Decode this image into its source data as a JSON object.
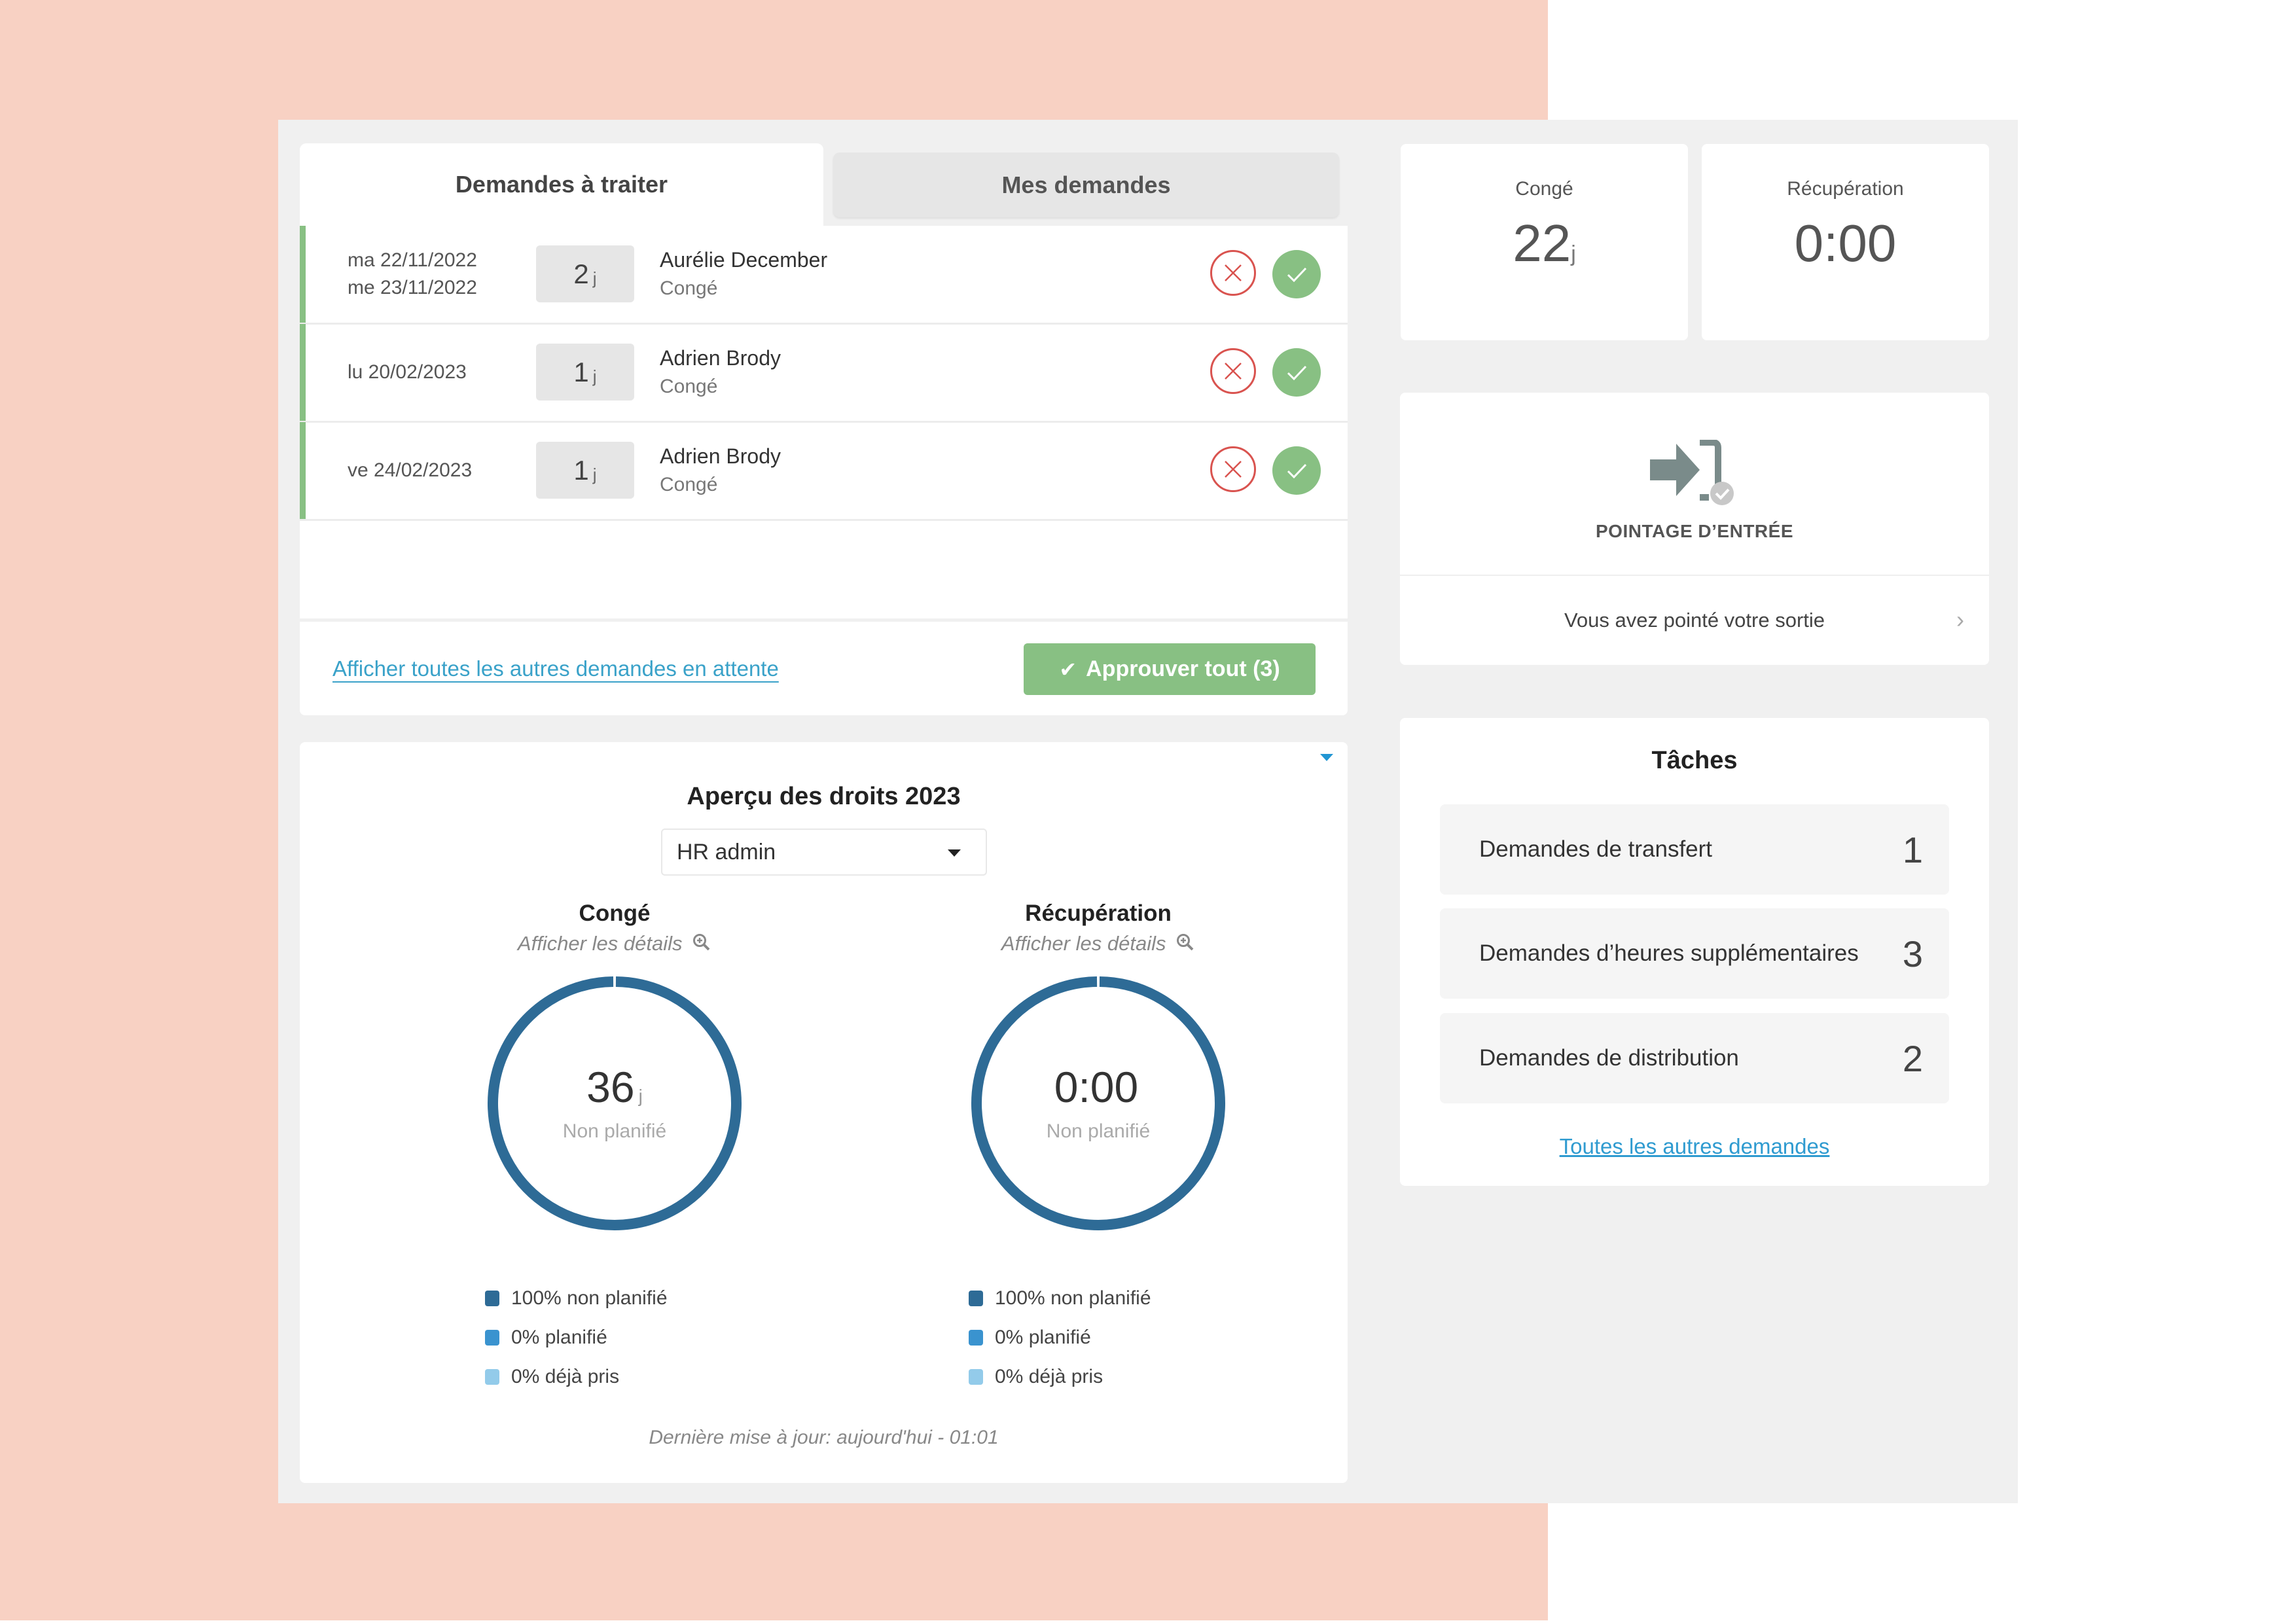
{
  "requests": {
    "tabs": [
      {
        "label": "Demandes à traiter",
        "active": true
      },
      {
        "label": "Mes demandes",
        "active": false
      }
    ],
    "rows": [
      {
        "dates": [
          "ma 22/11/2022",
          "me 23/11/2022"
        ],
        "days": "2",
        "unit": "j",
        "name": "Aurélie December",
        "type": "Congé"
      },
      {
        "dates": [
          "lu 20/02/2023"
        ],
        "days": "1",
        "unit": "j",
        "name": "Adrien Brody",
        "type": "Congé"
      },
      {
        "dates": [
          "ve 24/02/2023"
        ],
        "days": "1",
        "unit": "j",
        "name": "Adrien Brody",
        "type": "Congé"
      }
    ],
    "show_all_link": "Afficher toutes les autres demandes en attente",
    "approve_all_label": "Approuver tout (3)"
  },
  "entitlements": {
    "title": "Aperçu des droits 2023",
    "selected_user": "HR admin",
    "details_label": "Afficher les détails",
    "last_updated": "Dernière mise à jour: aujourd'hui - 01:01",
    "donuts": [
      {
        "title": "Congé",
        "value": "36",
        "unit": "j",
        "sublabel": "Non planifié",
        "segments": [
          {
            "label": "100% non planifié",
            "percent": 100,
            "color": "#2E6B96"
          },
          {
            "label": "0% planifié",
            "percent": 0,
            "color": "#3A93CF"
          },
          {
            "label": "0% déjà pris",
            "percent": 0,
            "color": "#93CBEA"
          }
        ]
      },
      {
        "title": "Récupération",
        "value": "0:00",
        "unit": "",
        "sublabel": "Non planifié",
        "segments": [
          {
            "label": "100% non planifié",
            "percent": 100,
            "color": "#2E6B96"
          },
          {
            "label": "0% planifié",
            "percent": 0,
            "color": "#3A93CF"
          },
          {
            "label": "0% déjà pris",
            "percent": 0,
            "color": "#93CBEA"
          }
        ]
      }
    ]
  },
  "stats": [
    {
      "label": "Congé",
      "value": "22",
      "unit": "j"
    },
    {
      "label": "Récupération",
      "value": "0:00",
      "unit": ""
    }
  ],
  "clock": {
    "icon": "clock-in-icon",
    "label": "POINTAGE D’ENTRÉE",
    "status": "Vous avez pointé votre sortie"
  },
  "tasks": {
    "title": "Tâches",
    "items": [
      {
        "label": "Demandes de transfert",
        "count": "1"
      },
      {
        "label": "Demandes d’heures supplémentaires",
        "count": "3"
      },
      {
        "label": "Demandes de distribution",
        "count": "2"
      }
    ],
    "all_link": "Toutes les autres demandes"
  },
  "colors": {
    "accent_green": "#88C083",
    "reject_red": "#D9534F",
    "link_blue": "#3AA2C9",
    "donut_blue": "#2E6B96",
    "background_pink": "#F8D1C3",
    "frame_gray": "#F0F0F0"
  }
}
